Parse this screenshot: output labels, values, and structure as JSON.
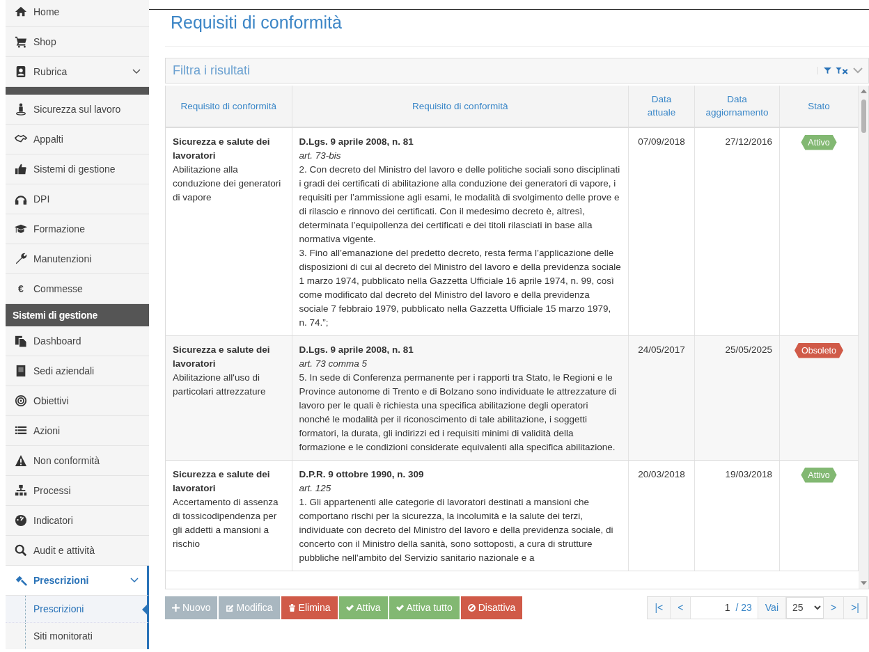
{
  "sidebar": {
    "items": [
      {
        "kind": "item",
        "label": "Home"
      },
      {
        "kind": "item",
        "label": "Shop"
      },
      {
        "kind": "item",
        "label": "Rubrica",
        "has_submenu": true,
        "active": false
      },
      {
        "kind": "divider"
      },
      {
        "kind": "item",
        "label": "Sicurezza sul lavoro"
      },
      {
        "kind": "item",
        "label": "Appalti"
      },
      {
        "kind": "item",
        "label": "Sistemi di gestione"
      },
      {
        "kind": "item",
        "label": "DPI"
      },
      {
        "kind": "item",
        "label": "Formazione"
      },
      {
        "kind": "item",
        "label": "Manutenzioni"
      },
      {
        "kind": "item",
        "label": "Commesse",
        "glyph": "€"
      },
      {
        "kind": "header",
        "label": "Sistemi di gestione"
      },
      {
        "kind": "item",
        "label": "Dashboard"
      },
      {
        "kind": "item",
        "label": "Sedi aziendali"
      },
      {
        "kind": "item",
        "label": "Obiettivi"
      },
      {
        "kind": "item",
        "label": "Azioni"
      },
      {
        "kind": "item",
        "label": "Non conformità"
      },
      {
        "kind": "item",
        "label": "Processi"
      },
      {
        "kind": "item",
        "label": "Indicatori"
      },
      {
        "kind": "item",
        "label": "Audit e attività"
      },
      {
        "kind": "item",
        "label": "Prescrizioni",
        "has_submenu": true,
        "active": true,
        "children": [
          {
            "label": "Prescrizioni",
            "selected": true
          },
          {
            "label": "Siti monitorati",
            "selected": false
          }
        ]
      }
    ]
  },
  "page_title": "Requisiti di conformità",
  "filter": {
    "title": "Filtra i risultati"
  },
  "table": {
    "columns": [
      "Requisito di conformità",
      "Requisito di conformità",
      "Data attuale",
      "Data aggiornamento",
      "Stato"
    ],
    "rows": [
      {
        "category": "Sicurezza e salute dei lavoratori",
        "description": "Abilitazione alla conduzione dei generatori di vapore",
        "law": "D.Lgs. 9 aprile 2008, n. 81",
        "article": "art. 73-bis",
        "paragraphs": [
          "2. Con decreto del Ministro del lavoro e delle politiche sociali sono disciplinati i gradi dei certificati di abilitazione alla conduzione dei generatori di vapore, i requisiti per l’ammissione agli esami, le modalità di svolgimento delle prove e di rilascio e rinnovo dei certificati. Con il medesimo decreto è, altresì, determinata l’equipollenza dei certificati e dei titoli rilasciati in base alla normativa vigente.",
          "3. Fino all’emanazione del predetto decreto, resta ferma l’applicazione delle disposizioni di cui al decreto del Ministro del lavoro e della previdenza sociale 1 marzo 1974, pubblicato nella Gazzetta Ufficiale 16 aprile 1974, n. 99, così come modificato dal decreto del Ministro del lavoro e della previdenza sociale 7 febbraio 1979, pubblicato nella Gazzetta Ufficiale 15 marzo 1979, n. 74.”;"
        ],
        "date_current": "07/09/2018",
        "date_updated": "27/12/2016",
        "status": {
          "kind": "active",
          "label": "Attivo"
        }
      },
      {
        "category": "Sicurezza e salute dei lavoratori",
        "description": "Abilitazione all'uso di particolari attrezzature",
        "law": "D.Lgs. 9 aprile 2008, n. 81",
        "article": "art. 73 comma 5",
        "paragraphs": [
          "5. In sede di Conferenza permanente per i rapporti tra Stato, le Regioni e le Province autonome di Trento e di Bolzano sono individuate le attrezzature di lavoro per le quali è richiesta una specifica abilitazione degli operatori nonché le modalità per il riconoscimento di tale abilitazione, i soggetti formatori, la durata, gli indirizzi ed i requisiti minimi di validità della formazione e le condizioni considerate equivalenti alla specifica abilitazione."
        ],
        "date_current": "24/05/2017",
        "date_updated": "25/05/2025",
        "status": {
          "kind": "obsolete",
          "label": "Obsoleto"
        }
      },
      {
        "category": "Sicurezza e salute dei lavoratori",
        "description": "Accertamento di assenza di tossicodipendenza per gli addetti a mansioni a rischio",
        "law": "D.P.R. 9 ottobre 1990, n. 309",
        "article": "art. 125",
        "paragraphs": [
          "1. Gli appartenenti alle categorie di lavoratori destinati a mansioni che comportano rischi per la sicurezza, la incolumità e la salute dei terzi, individuate con decreto del Ministro del lavoro e della previdenza sociale, di concerto con il Ministro della sanità, sono sottoposti, a cura di strutture pubbliche nell'ambito del Servizio sanitario nazionale e a"
        ],
        "date_current": "20/03/2018",
        "date_updated": "19/03/2018",
        "status": {
          "kind": "active",
          "label": "Attivo"
        }
      }
    ]
  },
  "actions": [
    {
      "kind": "neutral",
      "label": "Nuovo"
    },
    {
      "kind": "neutral",
      "label": "Modifica"
    },
    {
      "kind": "danger",
      "label": "Elimina"
    },
    {
      "kind": "success",
      "label": "Attiva"
    },
    {
      "kind": "success",
      "label": "Attiva tutto"
    },
    {
      "kind": "danger",
      "label": "Disattiva"
    }
  ],
  "pagination": {
    "first": "|<",
    "prev": "<",
    "page": "1",
    "total": "/ 23",
    "go": "Vai",
    "page_size": "25",
    "next": ">",
    "last": ">|"
  }
}
